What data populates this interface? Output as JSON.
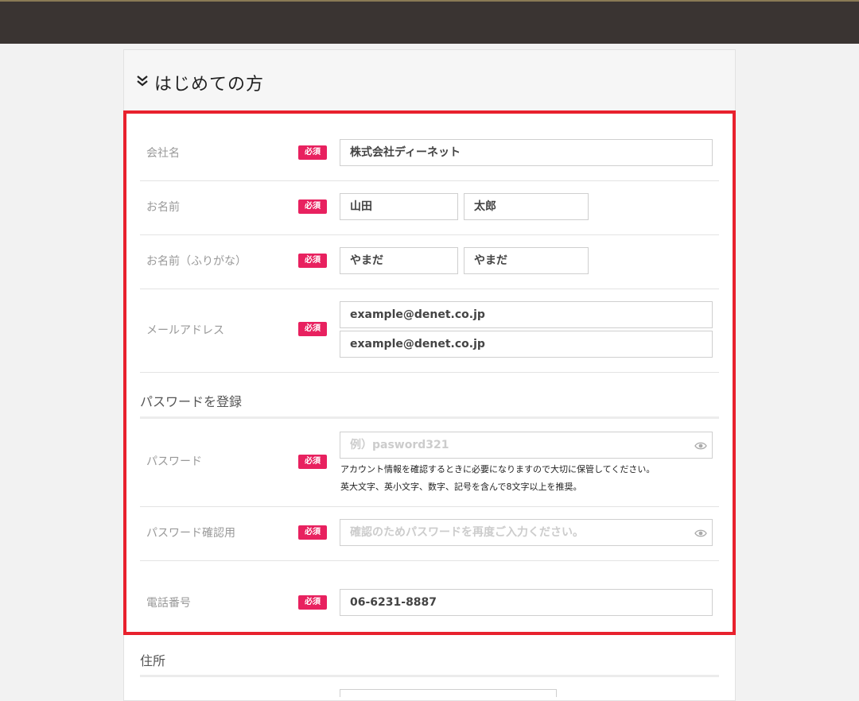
{
  "form": {
    "title": "はじめての方",
    "required_badge": "必須",
    "rows": {
      "company": {
        "label": "会社名",
        "value": "株式会社ディーネット"
      },
      "name": {
        "label": "お名前",
        "last": "山田",
        "first": "太郎"
      },
      "kana": {
        "label": "お名前（ふりがな）",
        "last": "やまだ",
        "first": "やまだ"
      },
      "email": {
        "label": "メールアドレス",
        "value": "example@denet.co.jp",
        "confirm": "example@denet.co.jp"
      }
    },
    "password_section": {
      "title": "パスワードを登録",
      "password": {
        "label": "パスワード",
        "placeholder": "例）pasword321",
        "help1": "アカウント情報を確認するときに必要になりますので大切に保管してください。",
        "help2": "英大文字、英小文字、数字、記号を含んで8文字以上を推奨。"
      },
      "confirm": {
        "label": "パスワード確認用",
        "placeholder": "確認のためパスワードを再度ご入力ください。"
      },
      "phone": {
        "label": "電話番号",
        "value": "06-6231-8887"
      }
    },
    "address_section": {
      "title": "住所"
    }
  },
  "colors": {
    "topbar": "#3a3432",
    "required": "#e8215f",
    "highlight": "#e8212d"
  }
}
